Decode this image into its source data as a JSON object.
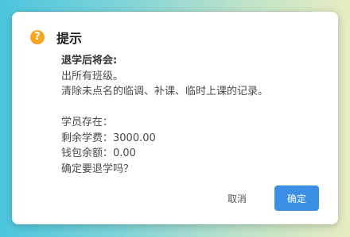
{
  "dialog": {
    "icon": "warning-icon",
    "icon_glyph": "?",
    "title": "提示",
    "heading": "退学后将会:",
    "lines_a": [
      "出所有班级。",
      "清除未点名的临调、补课、临时上课的记录。"
    ],
    "lines_b": [
      "学员存在：",
      "剩余学费：3000.00",
      "钱包余额：0.00",
      "确定要退学吗？"
    ],
    "cancel_label": "取消",
    "confirm_label": "确定"
  },
  "colors": {
    "primary": "#3a8ee6",
    "warning": "#f5a623"
  }
}
